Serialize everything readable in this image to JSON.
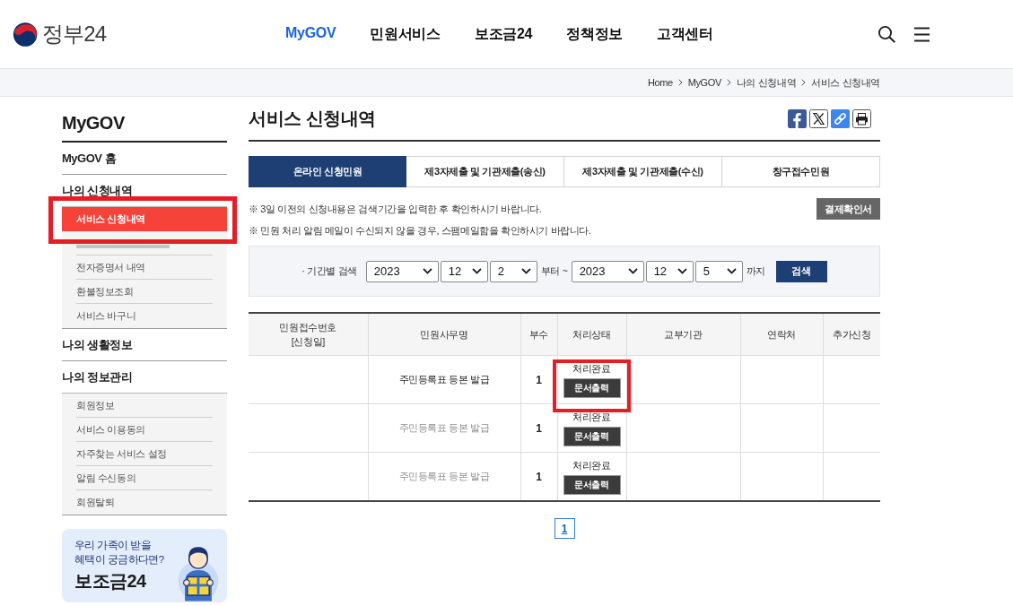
{
  "header": {
    "logo_text": "정부24",
    "nav": [
      {
        "label": "MyGOV",
        "selected": true
      },
      {
        "label": "민원서비스",
        "selected": false
      },
      {
        "label": "보조금24",
        "selected": false
      },
      {
        "label": "정책정보",
        "selected": false
      },
      {
        "label": "고객센터",
        "selected": false
      }
    ]
  },
  "breadcrumb": [
    "Home",
    "MyGOV",
    "나의 신청내역",
    "서비스 신청내역"
  ],
  "sidebar": {
    "title": "MyGOV",
    "sections": [
      {
        "label": "MyGOV 홈"
      },
      {
        "label": "나의 신청내역",
        "children": [
          {
            "label": "서비스 신청내역",
            "selected": true,
            "highlighted": true,
            "obscured": false
          },
          {
            "selected": false,
            "highlighted": false,
            "obscured": true
          },
          {
            "label": "전자증명서 내역",
            "selected": false,
            "highlighted": false,
            "obscured": false
          },
          {
            "label": "환불정보조회",
            "selected": false,
            "highlighted": false,
            "obscured": false
          },
          {
            "label": "서비스 바구니",
            "selected": false,
            "highlighted": false,
            "obscured": false
          }
        ]
      },
      {
        "label": "나의 생활정보"
      },
      {
        "label": "나의 정보관리",
        "children": [
          {
            "label": "회원정보",
            "selected": false,
            "highlighted": false,
            "obscured": false
          },
          {
            "label": "서비스 이용동의",
            "selected": false,
            "highlighted": false,
            "obscured": false
          },
          {
            "label": "자주찾는 서비스 설정",
            "selected": false,
            "highlighted": false,
            "obscured": false
          },
          {
            "label": "알림 수신동의",
            "selected": false,
            "highlighted": false,
            "obscured": false
          },
          {
            "label": "회원탈퇴",
            "selected": false,
            "highlighted": false,
            "obscured": false
          }
        ]
      }
    ],
    "banner": {
      "text": "우리 가족이 받을\n혜택이 궁금하다면?",
      "title": "보조금24"
    }
  },
  "main": {
    "title": "서비스 신청내역",
    "tabs": [
      {
        "label": "온라인 신청민원",
        "selected": true
      },
      {
        "label": "제3자제출 및 기관제출(송신)",
        "selected": false
      },
      {
        "label": "제3자제출 및 기관제출(수신)",
        "selected": false
      },
      {
        "label": "창구접수민원",
        "selected": false
      }
    ],
    "notices": [
      "※ 3일 이전의 신청내용은 검색기간을 입력한 후 확인하시기 바랍니다.",
      "※ 민원 처리 알림 메일이 수신되지 않을 경우, 스팸메일함을 확인하시기 바랍니다."
    ],
    "receipt_button": "결제확인서",
    "search": {
      "label": "· 기간별 검색",
      "from": [
        "2023",
        "12",
        "2"
      ],
      "from_suffix": "부터 ~",
      "to": [
        "2023",
        "12",
        "5"
      ],
      "to_suffix": "까지",
      "button": "검색"
    },
    "table": {
      "columns": [
        "민원접수번호\n[신청일]",
        "민원사무명",
        "부수",
        "처리상태",
        "교부기관",
        "연락처",
        "추가신청"
      ],
      "rows": [
        {
          "service": "주민등록표 등본 발급",
          "masked": false,
          "copies": "1",
          "status": "처리완료",
          "action": "문서출력",
          "highlighted": true
        },
        {
          "service": "주민등록표 등본 발급",
          "masked": true,
          "copies": "1",
          "status": "처리완료",
          "action": "문서출력",
          "highlighted": false
        },
        {
          "service": "주민등록표 등본 발급",
          "masked": true,
          "copies": "1",
          "status": "처리완료",
          "action": "문서출력",
          "highlighted": false
        }
      ]
    },
    "pagination": [
      {
        "label": "1",
        "selected": true
      }
    ]
  }
}
